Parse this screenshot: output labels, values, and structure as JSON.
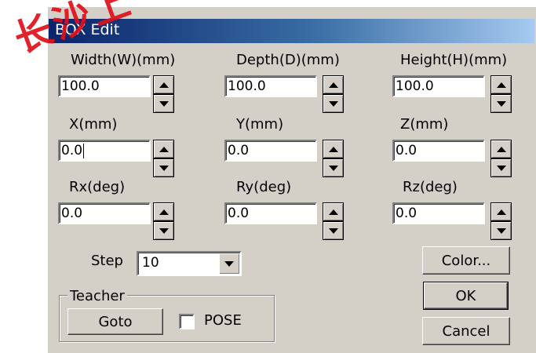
{
  "window": {
    "title": "BOX Edit"
  },
  "watermark": {
    "text": "长沙上",
    "color": "#e0101a"
  },
  "colors": {
    "dialog_bg": "#d4d0c8",
    "title_start": "#0a246a",
    "title_end": "#a6caf0"
  },
  "fields": [
    {
      "label": "Width(W)(mm)",
      "value": "100.0"
    },
    {
      "label": "Depth(D)(mm)",
      "value": "100.0"
    },
    {
      "label": "Height(H)(mm)",
      "value": "100.0"
    },
    {
      "label": "X(mm)",
      "value": "0.0"
    },
    {
      "label": "Y(mm)",
      "value": "0.0"
    },
    {
      "label": "Z(mm)",
      "value": "0.0"
    },
    {
      "label": "Rx(deg)",
      "value": "0.0"
    },
    {
      "label": "Ry(deg)",
      "value": "0.0"
    },
    {
      "label": "Rz(deg)",
      "value": "0.0"
    }
  ],
  "step": {
    "label": "Step",
    "value": "10"
  },
  "teacher": {
    "legend": "Teacher",
    "goto_label": "Goto",
    "pose_label": "POSE",
    "pose_checked": false
  },
  "buttons": {
    "color_label": "Color...",
    "ok_label": "OK",
    "cancel_label": "Cancel"
  },
  "icons": {
    "spin_up": "triangle-up-icon",
    "spin_down": "triangle-down-icon",
    "dropdown": "chevron-down-icon"
  }
}
